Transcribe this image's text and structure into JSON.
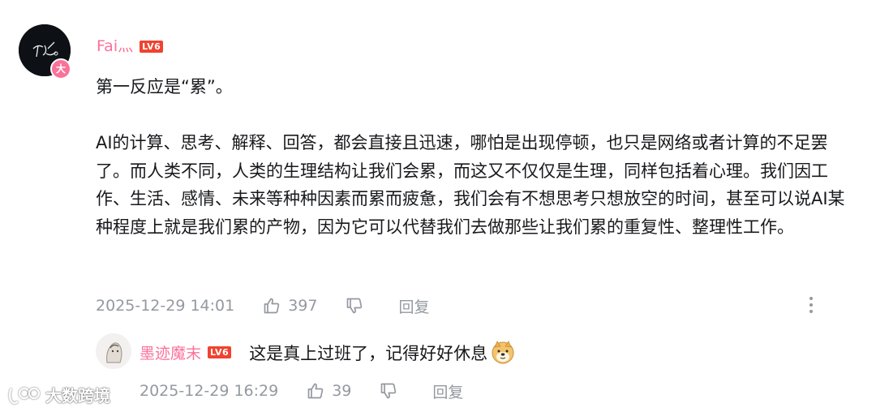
{
  "comment": {
    "username": "Fai",
    "username_suffix": "灬",
    "level": "LV6",
    "avatar_badge": "大",
    "paragraphs": [
      "第一反应是“累”。",
      "AI的计算、思考、解释、回答，都会直接且迅速，哪怕是出现停顿，也只是网络或者计算的不足罢了。而人类不同，人类的生理结构让我们会累，而这又不仅仅是生理，同样包括着心理。我们因工作、生活、感情、未来等种种因素而累而疲惫，我们会有不想思考只想放空的时间，甚至可以说AI某种程度上就是我们累的产物，因为它可以代替我们去做那些让我们累的重复性、整理性工作。"
    ],
    "time": "2025-12-29 14:01",
    "like_count": "397",
    "reply_label": "回复"
  },
  "reply": {
    "username": "墨迹魔末",
    "level": "LV6",
    "text": "这是真上过班了，记得好好休息",
    "emoji": "doge-emoji",
    "time": "2025-12-29 16:29",
    "like_count": "39",
    "reply_label": "回复"
  },
  "watermark": {
    "text": "大数跨境"
  },
  "icons": {
    "like": "thumb-up-icon",
    "dislike": "thumb-down-icon",
    "more": "more-vertical-icon"
  },
  "colors": {
    "username": "#fb7299",
    "level_badge": "#f0432f",
    "meta": "#9499a0",
    "text": "#18191c"
  }
}
